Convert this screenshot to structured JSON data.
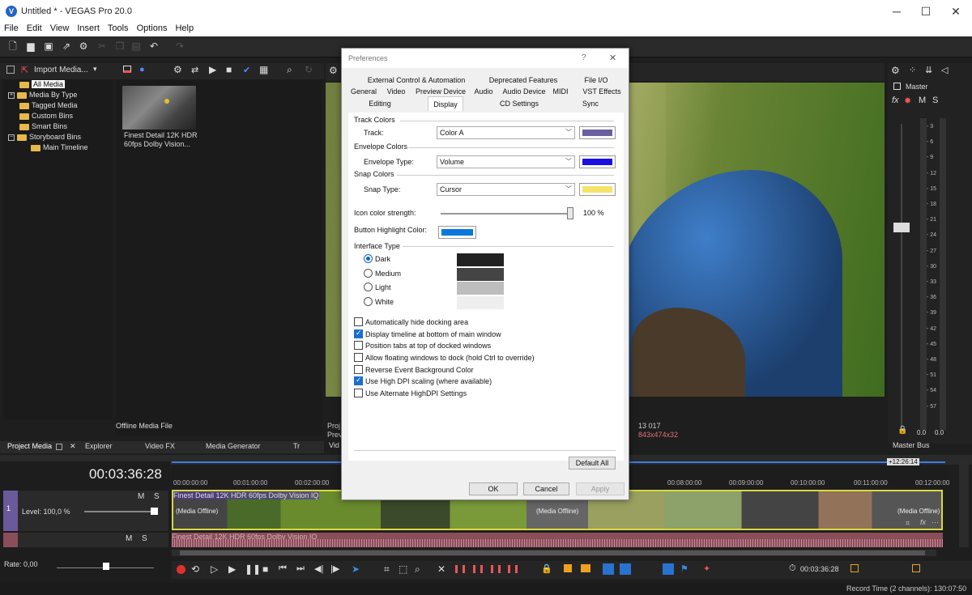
{
  "window": {
    "title": "Untitled * - VEGAS Pro 20.0",
    "logo": "V"
  },
  "menu": [
    "File",
    "Edit",
    "View",
    "Insert",
    "Tools",
    "Options",
    "Help"
  ],
  "media_panel": {
    "import_label": "Import Media...",
    "tree": [
      "All Media",
      "Media By Type",
      "Tagged Media",
      "Custom Bins",
      "Smart Bins",
      "Storyboard Bins",
      "Main Timeline"
    ],
    "thumb_caption_1": "Finest Detail 12K HDR",
    "thumb_caption_2": "60fps  Dolby Vision...",
    "footer": "Offline Media File"
  },
  "lower_tabs": [
    "Project Media",
    "Explorer",
    "Video FX",
    "Media Generator",
    "Tr"
  ],
  "preview": {
    "info_left": "Proj",
    "info_left2": "Prev",
    "info_mid": "13 017",
    "info_res": "843x474x32",
    "vid": "Vid"
  },
  "master": {
    "label": "Master",
    "fx": "fx",
    "m": "M",
    "s": "S",
    "scale": [
      "3",
      "6",
      "9",
      "12",
      "15",
      "18",
      "21",
      "24",
      "27",
      "30",
      "33",
      "36",
      "39",
      "42",
      "45",
      "48",
      "51",
      "54",
      "57"
    ],
    "foot_left": "0.0",
    "foot_right": "0.0",
    "bus_label": "Master Bus"
  },
  "timeline": {
    "timecode": "00:03:36:28",
    "ruler": [
      "00:00:00:00",
      "00:01:00:00",
      "00:02:00:00",
      "00:08:00:00",
      "00:09:00:00",
      "00:10:00:00",
      "00:11:00:00",
      "00:12:00:00"
    ],
    "marker": "+12:26:14",
    "track1_title": "Finest Detail 12K HDR 60fps  Dolby Vision IQ",
    "track2_title": "Finest Detail 12K HDR 60fps  Dolby Vision IQ",
    "offline_label": "(Media Offline)",
    "level": "Level: 100,0 %",
    "rate": "Rate: 0,00",
    "m": "M",
    "s": "S",
    "track_num": "1",
    "transport_time": "00:03:36:28"
  },
  "status": {
    "record": "Record Time (2 channels): 130:07:50"
  },
  "dialog": {
    "title": "Preferences",
    "help": "?",
    "close": "✕",
    "tabs_row1": [
      "External Control & Automation",
      "Deprecated Features",
      "File I/O"
    ],
    "tabs_row2": [
      "General",
      "Video",
      "Preview Device",
      "Audio",
      "Audio Device",
      "MIDI",
      "VST Effects"
    ],
    "tabs_row3": [
      "Editing",
      "Display",
      "CD Settings",
      "Sync"
    ],
    "track_colors": "Track Colors",
    "track_label": "Track:",
    "track_value": "Color A",
    "track_color": "#6a60a0",
    "envelope_colors": "Envelope Colors",
    "envelope_label": "Envelope Type:",
    "envelope_value": "Volume",
    "envelope_color": "#1a0ee0",
    "snap_colors": "Snap Colors",
    "snap_label": "Snap Type:",
    "snap_value": "Cursor",
    "snap_color": "#f4e46a",
    "icon_strength_label": "Icon color strength:",
    "icon_strength_value": "100 %",
    "icon_strength_fraction": 1.0,
    "button_highlight_label": "Button Highlight Color:",
    "button_highlight_color": "#0a78d8",
    "interface_type": "Interface Type",
    "themes": [
      {
        "label": "Dark",
        "color": "#222222",
        "selected": true
      },
      {
        "label": "Medium",
        "color": "#444444",
        "selected": false
      },
      {
        "label": "Light",
        "color": "#bdbdbd",
        "selected": false
      },
      {
        "label": "White",
        "color": "#eeeeee",
        "selected": false
      }
    ],
    "options": [
      {
        "label": "Automatically hide docking area",
        "checked": false
      },
      {
        "label": "Display timeline at bottom of main window",
        "checked": true
      },
      {
        "label": "Position tabs at top of docked windows",
        "checked": false
      },
      {
        "label": "Allow floating windows to dock (hold Ctrl to override)",
        "checked": false
      },
      {
        "label": "Reverse Event Background Color",
        "checked": false
      },
      {
        "label": "Use High DPI scaling (where available)",
        "checked": true
      },
      {
        "label": "Use Alternate HighDPI Settings",
        "checked": false
      }
    ],
    "default_all": "Default All",
    "ok": "OK",
    "cancel": "Cancel",
    "apply": "Apply"
  }
}
